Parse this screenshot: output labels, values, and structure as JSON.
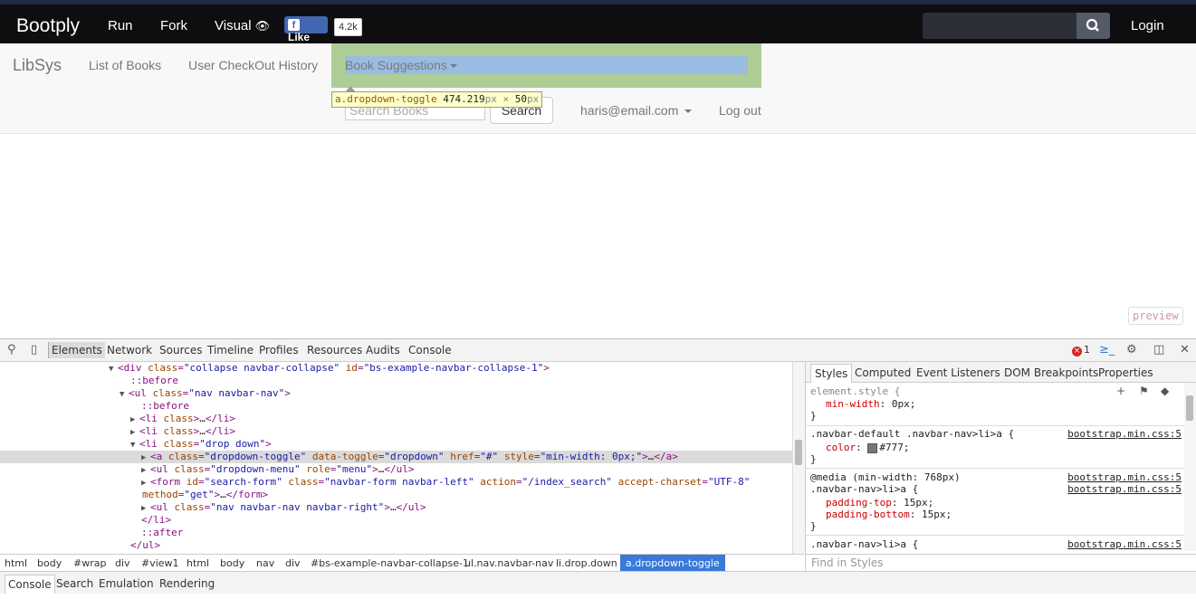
{
  "topbar": {
    "brand": "Bootply",
    "nav": [
      "Run",
      "Fork",
      "Visual"
    ],
    "fb_like": "Like",
    "fb_count": "4.2k",
    "login": "Login",
    "search_icon": "search-icon",
    "visual_icon": "eye-icon"
  },
  "app": {
    "brand": "LibSys",
    "links": [
      "List of Books",
      "User CheckOut History"
    ],
    "dropdown": "Book Suggestions",
    "search_placeholder": "Search Books",
    "search_button": "Search",
    "user": "haris@email.com",
    "logout": "Log out"
  },
  "inspect_tooltip": {
    "selector": "a.dropdown-toggle",
    "width": "474.219",
    "height": "50",
    "unit": "px",
    "times": "×"
  },
  "preview_label": "preview",
  "devtools": {
    "tabs": [
      "Elements",
      "Network",
      "Sources",
      "Timeline",
      "Profiles",
      "Resources",
      "Audits",
      "Console"
    ],
    "error_count": "1",
    "dom_lines": [
      {
        "tri": "▼",
        "tag_open": "<div ",
        "attrs": [
          {
            "n": "class",
            "v": "collapse navbar-collapse"
          },
          {
            "n": "id",
            "v": "bs-example-navbar-collapse-1"
          }
        ],
        "tail": ">"
      },
      {
        "pseudo": "::before"
      },
      {
        "tri": "▼",
        "tag_open": "<ul ",
        "attrs": [
          {
            "n": "class",
            "v": "nav navbar-nav"
          }
        ],
        "tail": ">"
      },
      {
        "pseudo": "::before"
      },
      {
        "tri": "▶",
        "tag_open": "<li ",
        "attrs": [
          {
            "n": "class",
            "v": ""
          }
        ],
        "tail": ">…</li>",
        "raw": "<li class>…</li>"
      },
      {
        "tri": "▶",
        "raw": "<li class>…</li>"
      },
      {
        "tri": "▼",
        "raw": "<li class=\"drop down\">"
      },
      {
        "tri": "▶",
        "raw": "<a class=\"dropdown-toggle\" data-toggle=\"dropdown\" href=\"#\" style=\"min-width: 0px;\">…</a>"
      },
      {
        "tri": "▶",
        "raw": "<ul class=\"dropdown-menu\" role=\"menu\">…</ul>"
      },
      {
        "tri": "▶",
        "raw": "<form id=\"search-form\" class=\"navbar-form navbar-left\" action=\"/index_search\" accept-charset=\"UTF-8\""
      },
      {
        "raw": "method=\"get\">…</form>"
      },
      {
        "tri": "▶",
        "raw": "<ul class=\"nav navbar-nav navbar-right\">…</ul>"
      },
      {
        "raw": "</li>"
      },
      {
        "pseudo": "::after"
      },
      {
        "raw": "</ul>"
      }
    ],
    "breadcrumbs": [
      "html",
      "body",
      "#wrap",
      "div",
      "#view1",
      "html",
      "body",
      "nav",
      "div",
      "#bs-example-navbar-collapse-1",
      "ul.nav.navbar-nav",
      "li.drop.down",
      "a.dropdown-toggle"
    ],
    "style_tabs": [
      "Styles",
      "Computed",
      "Event Listeners",
      "DOM Breakpoints",
      "Properties"
    ],
    "styles": {
      "element_style": "element.style {",
      "min_width_prop": "min-width",
      "min_width_val": "0px;",
      "close": "}",
      "rule1_sel": ".navbar-default .navbar-nav>li>a {",
      "rule1_src": "bootstrap.min.css:5",
      "color_prop": "color",
      "color_val": "#777;",
      "media": "@media (min-width: 768px)",
      "media_src": "bootstrap.min.css:5",
      "rule2_sel": ".navbar-nav>li>a {",
      "rule2_src": "bootstrap.min.css:5",
      "pt_prop": "padding-top",
      "pt_val": "15px;",
      "pb_prop": "padding-bottom",
      "pb_val": "15px;",
      "rule3_sel": ".navbar-nav>li>a {",
      "rule3_src": "bootstrap.min.css:5"
    },
    "find_placeholder": "Find in Styles",
    "drawer_tabs": [
      "Console",
      "Search",
      "Emulation",
      "Rendering"
    ]
  }
}
